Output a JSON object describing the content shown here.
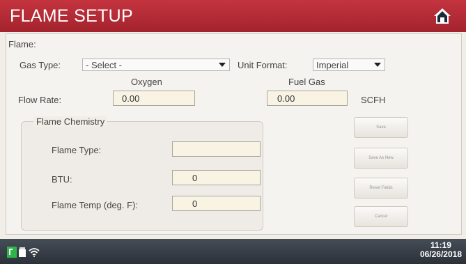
{
  "header": {
    "title": "FLAME SETUP",
    "home_icon": "home-icon"
  },
  "form": {
    "section_label": "Flame:",
    "gas_type_label": "Gas Type:",
    "gas_type_value": "- Select -",
    "unit_format_label": "Unit Format:",
    "unit_format_value": "Imperial",
    "oxygen_header": "Oxygen",
    "fuel_gas_header": "Fuel Gas",
    "flow_rate_label": "Flow Rate:",
    "oxygen_flow_value": "0.00",
    "fuel_flow_value": "0.00",
    "flow_unit": "SCFH"
  },
  "chemistry": {
    "legend": "Flame Chemistry",
    "flame_type_label": "Flame Type:",
    "flame_type_value": "",
    "btu_label": "BTU:",
    "btu_value": "0",
    "flame_temp_label": "Flame Temp (deg. F):",
    "flame_temp_value": "0"
  },
  "buttons": {
    "save": "Save",
    "save_as_new": "Save As New",
    "reset_fields": "Reset Fields",
    "cancel": "Cancel"
  },
  "status_bar": {
    "time": "11:19",
    "date": "06/26/2018",
    "icons": [
      "battery-icon",
      "lock-icon",
      "wifi-icon"
    ]
  },
  "colors": {
    "title_bar": "#b42a35",
    "status_bar": "#363d46",
    "field_bg": "#f8f3e3",
    "battery_green": "#2fb44a"
  }
}
